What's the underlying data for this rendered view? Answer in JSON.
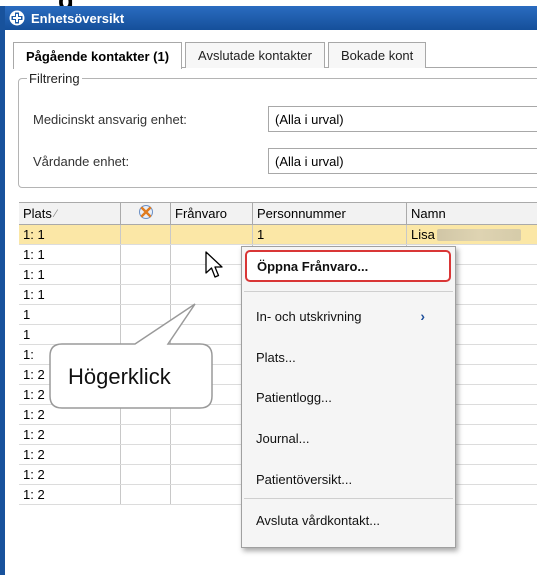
{
  "heading_fragment": "g",
  "window": {
    "title": "Enhetsöversikt",
    "icon": "plus-cross-icon"
  },
  "tabs": [
    {
      "label": "Pågående kontakter (1)",
      "active": true
    },
    {
      "label": "Avslutade kontakter",
      "active": false
    },
    {
      "label": "Bokade kont",
      "active": false
    }
  ],
  "filter": {
    "legend": "Filtrering",
    "rows": [
      {
        "label": "Medicinskt ansvarig enhet:",
        "value": "(Alla i urval)"
      },
      {
        "label": "Vårdande enhet:",
        "value": "(Alla i urval)"
      }
    ]
  },
  "grid": {
    "columns": [
      "Plats",
      "",
      "Frånvaro",
      "Personnummer",
      "Namn"
    ],
    "column_icons": {
      "1": "cancel-x-icon"
    },
    "sort_indicator": "⁄",
    "rows": [
      {
        "plats": "1: 1",
        "personnummer": "1",
        "namn": "Lisa",
        "selected": true
      },
      {
        "plats": "1: 1"
      },
      {
        "plats": "1: 1"
      },
      {
        "plats": "1: 1"
      },
      {
        "plats": "1"
      },
      {
        "plats": "1"
      },
      {
        "plats": "1:"
      },
      {
        "plats": "1: 2"
      },
      {
        "plats": "1: 2"
      },
      {
        "plats": "1: 2"
      },
      {
        "plats": "1: 2"
      },
      {
        "plats": "1: 2"
      },
      {
        "plats": "1: 2"
      },
      {
        "plats": "1: 2"
      }
    ]
  },
  "context_menu": {
    "items": [
      {
        "label": "Öppna Frånvaro...",
        "highlighted": true
      },
      {
        "label": "In- och utskrivning",
        "submenu": true
      },
      {
        "label": "Plats..."
      },
      {
        "label": "Patientlogg..."
      },
      {
        "label": "Journal..."
      },
      {
        "label": "Patientöversikt..."
      },
      {
        "label": "Avsluta vårdkontakt..."
      }
    ],
    "submenu_glyph": "›"
  },
  "callout": {
    "text": "Högerklick"
  },
  "colors": {
    "title_bar": "#1b5aa8",
    "selected_row": "#fbe7a6",
    "highlight_border": "#d93636"
  }
}
